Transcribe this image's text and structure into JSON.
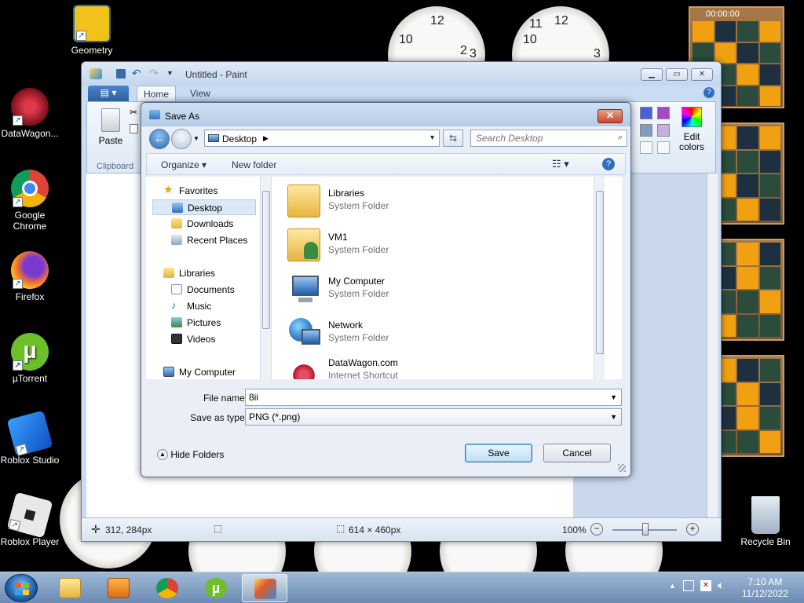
{
  "desktop": {
    "icons": [
      {
        "label": "Geometry",
        "icon": "geometry-dash-icon",
        "color": "#f2c21b"
      },
      {
        "label": "DataWagon...",
        "icon": "datawagon-icon",
        "color": "#b3182c"
      },
      {
        "label": "Google Chrome",
        "icon": "chrome-icon",
        "color": "#4285f4"
      },
      {
        "label": "Firefox",
        "icon": "firefox-icon",
        "color": "#ff7a1a"
      },
      {
        "label": "µTorrent",
        "icon": "utorrent-icon",
        "color": "#6dbf2a"
      },
      {
        "label": "Roblox Studio",
        "icon": "roblox-studio-icon",
        "color": "#1f7ae0"
      },
      {
        "label": "Roblox Player",
        "icon": "roblox-player-icon",
        "color": "#e8e8e8"
      },
      {
        "label": "Recycle Bin",
        "icon": "recycle-bin-icon",
        "color": "#cfd8e3"
      }
    ],
    "puzzle_timer": "00:00:00"
  },
  "paint": {
    "title": "Untitled - Paint",
    "tabs": [
      "Home",
      "View"
    ],
    "ribbon": {
      "paste": "Paste",
      "clipboard": "Clipboard",
      "edit_colors": "Edit colors"
    },
    "status": {
      "cursor": "312, 284px",
      "size": "614 × 460px",
      "zoom": "100%"
    }
  },
  "dialog": {
    "title": "Save As",
    "location": "Desktop",
    "search_placeholder": "Search Desktop",
    "organize": "Organize",
    "new_folder": "New folder",
    "nav": {
      "favorites": "Favorites",
      "desktop": "Desktop",
      "downloads": "Downloads",
      "recent": "Recent Places",
      "libraries": "Libraries",
      "documents": "Documents",
      "music": "Music",
      "pictures": "Pictures",
      "videos": "Videos",
      "computer": "My Computer"
    },
    "files": [
      {
        "name": "Libraries",
        "type": "System Folder"
      },
      {
        "name": "VM1",
        "type": "System Folder"
      },
      {
        "name": "My Computer",
        "type": "System Folder"
      },
      {
        "name": "Network",
        "type": "System Folder"
      },
      {
        "name": "DataWagon.com",
        "type": "Internet Shortcut"
      }
    ],
    "file_name_label": "File name:",
    "file_name_value": "8ii",
    "save_type_label": "Save as type:",
    "save_type_value": "PNG (*.png)",
    "hide_folders": "Hide Folders",
    "save": "Save",
    "cancel": "Cancel"
  },
  "taskbar": {
    "time": "7:10 AM",
    "date": "11/12/2022",
    "apps": [
      "file-explorer-icon",
      "media-player-icon",
      "chrome-icon",
      "utorrent-icon",
      "paint-icon"
    ]
  }
}
